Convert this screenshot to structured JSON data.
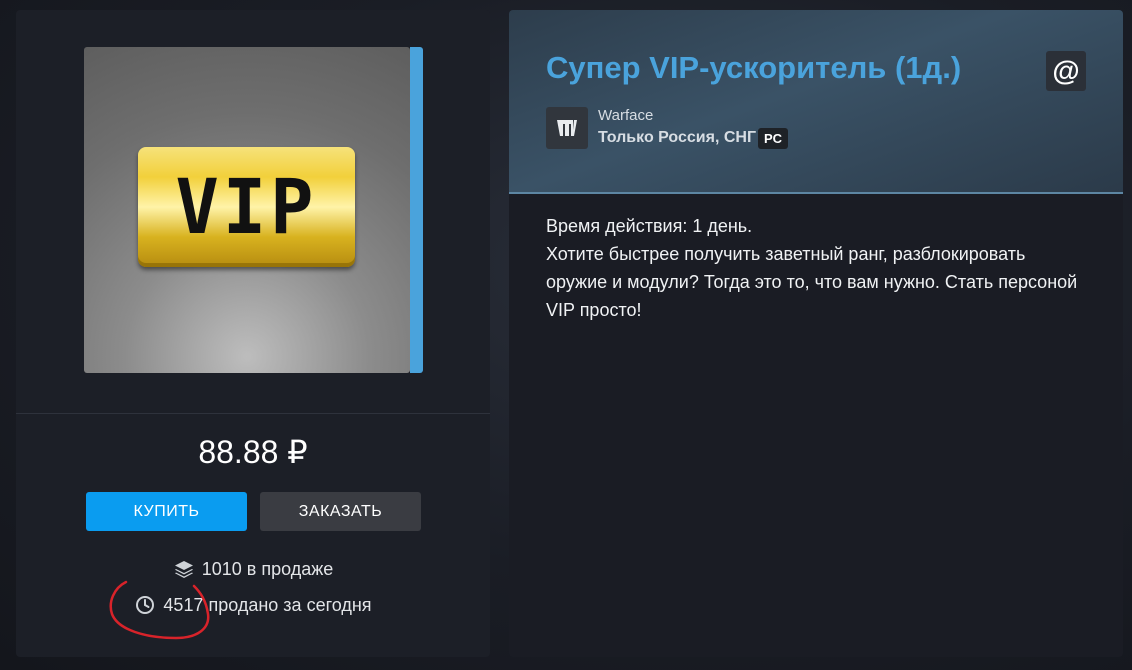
{
  "product": {
    "image_text": "VIP",
    "price": "88.88 ₽",
    "buy_label": "КУПИТЬ",
    "order_label": "ЗАКАЗАТЬ",
    "in_stock": "1010 в продаже",
    "sold_today": "4517 продано за сегодня"
  },
  "details": {
    "title": "Супер VIP-ускоритель (1д.)",
    "share_icon": "@",
    "game": "Warface",
    "region": "Только Россия, СНГ",
    "platform": "PC",
    "description": [
      "Время действия: 1 день.",
      "Хотите быстрее получить заветный ранг, разблокировать оружие и модули? Тогда это то, что вам нужно. Стать персоной VIP просто!"
    ]
  },
  "colors": {
    "accent": "#4aa3dc",
    "buy": "#0a9cf0",
    "order": "#3a3c42",
    "annotation": "#d8232a"
  },
  "icons": {
    "stock": "layers-icon",
    "sold": "clock-icon",
    "share": "at-sign-icon",
    "game": "warface-logo-icon"
  }
}
